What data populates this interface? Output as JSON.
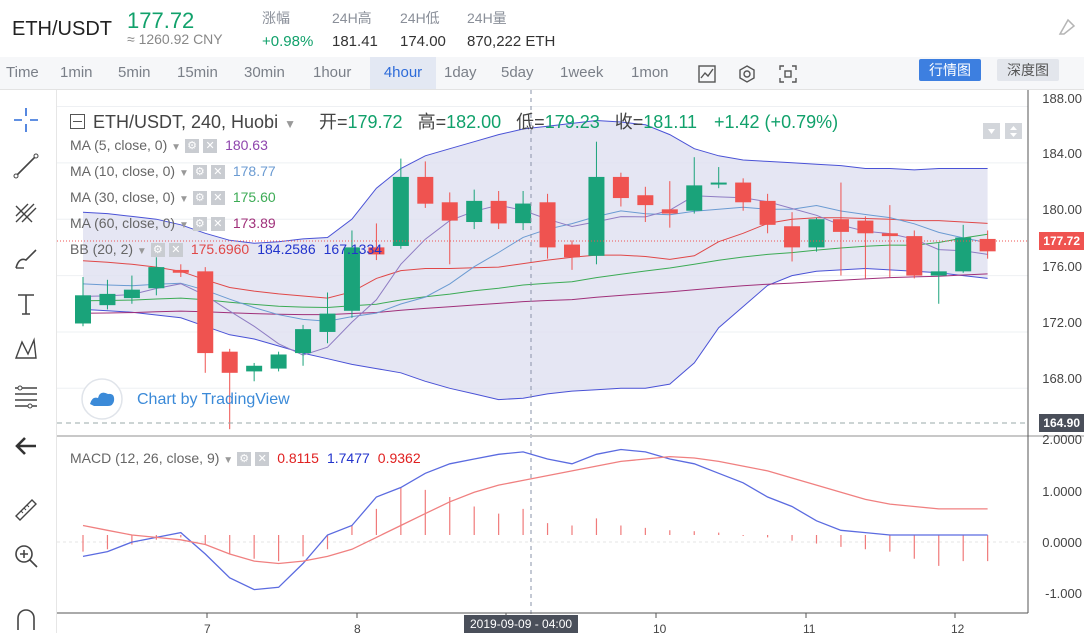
{
  "ticker": {
    "pair": "ETH/USDT",
    "price": "177.72",
    "cny": "≈ 1260.92 CNY",
    "stats": [
      {
        "label": "涨幅",
        "value": "+0.98%",
        "color": "green"
      },
      {
        "label": "24H高",
        "value": "181.41"
      },
      {
        "label": "24H低",
        "value": "174.00"
      },
      {
        "label": "24H量",
        "value": "870,222 ETH"
      }
    ]
  },
  "timeframes": [
    "Time",
    "1min",
    "5min",
    "15min",
    "30min",
    "1hour",
    "4hour",
    "1day",
    "5day",
    "1week",
    "1mon"
  ],
  "active_timeframe": "4hour",
  "view_modes": {
    "kline": "行情图",
    "depth": "深度图"
  },
  "chart_header": {
    "symbol": "ETH/USDT, 240, Huobi",
    "open_label": "开=",
    "open": "179.72",
    "high_label": "高=",
    "high": "182.00",
    "low_label": "低=",
    "low": "179.23",
    "close_label": "收=",
    "close": "181.11",
    "change": "+1.42 (+0.79%)"
  },
  "indicators": [
    {
      "name": "MA (5, close, 0)",
      "value": "180.63",
      "color": "#8e44ad"
    },
    {
      "name": "MA (10, close, 0)",
      "value": "178.77",
      "color": "#6b9bd2"
    },
    {
      "name": "MA (30, close, 0)",
      "value": "175.60",
      "color": "#3cab55"
    },
    {
      "name": "MA (60, close, 0)",
      "value": "173.89",
      "color": "#a0307a"
    }
  ],
  "bb": {
    "name": "BB (20, 2)",
    "v1": "175.6960",
    "v2": "184.2586",
    "v3": "167.1334"
  },
  "macd": {
    "name": "MACD (12, 26, close, 9)",
    "v1": "0.8115",
    "v2": "1.7477",
    "v3": "0.9362"
  },
  "watermark": "Chart by TradingView",
  "price_axis": [
    "188.00",
    "184.00",
    "180.00",
    "176.00",
    "172.00",
    "168.00"
  ],
  "macd_axis": [
    "2.0000",
    "1.0000",
    "0.0000",
    "-1.000"
  ],
  "current_price_badge": "177.72",
  "low_badge": "164.90",
  "crosshair_time": "2019-09-09 - 04:00",
  "x_labels": [
    "7",
    "8",
    "9",
    "10",
    "11",
    "12"
  ],
  "colors": {
    "up": "#1aa37a",
    "down": "#ef5350",
    "accent": "#3d7fe0"
  },
  "chart_data": {
    "type": "candlestick",
    "interval": "4hour",
    "candles": [
      {
        "o": 172.6,
        "h": 175.9,
        "l": 172.4,
        "c": 174.6
      },
      {
        "o": 173.9,
        "h": 175.7,
        "l": 173.6,
        "c": 174.7
      },
      {
        "o": 174.4,
        "h": 176.0,
        "l": 174.0,
        "c": 175.0
      },
      {
        "o": 175.1,
        "h": 177.3,
        "l": 174.6,
        "c": 176.6
      },
      {
        "o": 176.4,
        "h": 176.8,
        "l": 175.9,
        "c": 176.2
      },
      {
        "o": 176.3,
        "h": 176.6,
        "l": 169.1,
        "c": 170.5
      },
      {
        "o": 170.6,
        "h": 170.8,
        "l": 165.1,
        "c": 169.1
      },
      {
        "o": 169.2,
        "h": 169.8,
        "l": 168.5,
        "c": 169.6
      },
      {
        "o": 169.4,
        "h": 170.6,
        "l": 169.2,
        "c": 170.4
      },
      {
        "o": 170.5,
        "h": 172.5,
        "l": 169.6,
        "c": 172.2
      },
      {
        "o": 172.0,
        "h": 174.8,
        "l": 171.2,
        "c": 173.3
      },
      {
        "o": 173.5,
        "h": 179.2,
        "l": 173.0,
        "c": 178.0
      },
      {
        "o": 178.0,
        "h": 179.7,
        "l": 177.1,
        "c": 177.5
      },
      {
        "o": 178.1,
        "h": 184.3,
        "l": 177.9,
        "c": 183.0
      },
      {
        "o": 183.0,
        "h": 184.1,
        "l": 180.8,
        "c": 181.1
      },
      {
        "o": 181.2,
        "h": 181.9,
        "l": 176.8,
        "c": 179.9
      },
      {
        "o": 179.8,
        "h": 182.1,
        "l": 179.3,
        "c": 181.3
      },
      {
        "o": 181.3,
        "h": 182.0,
        "l": 179.3,
        "c": 179.7
      },
      {
        "o": 179.72,
        "h": 182.0,
        "l": 179.23,
        "c": 181.11
      },
      {
        "o": 181.2,
        "h": 181.8,
        "l": 177.2,
        "c": 178.0
      },
      {
        "o": 178.2,
        "h": 178.5,
        "l": 176.4,
        "c": 177.3
      },
      {
        "o": 177.4,
        "h": 185.5,
        "l": 176.8,
        "c": 183.0
      },
      {
        "o": 183.0,
        "h": 183.3,
        "l": 180.9,
        "c": 181.5
      },
      {
        "o": 181.7,
        "h": 182.3,
        "l": 179.8,
        "c": 181.0
      },
      {
        "o": 180.7,
        "h": 182.7,
        "l": 179.4,
        "c": 180.4
      },
      {
        "o": 180.6,
        "h": 184.4,
        "l": 180.4,
        "c": 182.4
      },
      {
        "o": 182.6,
        "h": 183.7,
        "l": 182.2,
        "c": 182.6
      },
      {
        "o": 182.6,
        "h": 182.9,
        "l": 180.6,
        "c": 181.2
      },
      {
        "o": 181.3,
        "h": 181.8,
        "l": 179.0,
        "c": 179.6
      },
      {
        "o": 179.5,
        "h": 180.5,
        "l": 177.0,
        "c": 178.0
      },
      {
        "o": 178.0,
        "h": 180.1,
        "l": 177.7,
        "c": 180.0
      },
      {
        "o": 180.0,
        "h": 182.6,
        "l": 176.0,
        "c": 179.1
      },
      {
        "o": 179.9,
        "h": 180.2,
        "l": 175.8,
        "c": 179.0
      },
      {
        "o": 179.0,
        "h": 181.0,
        "l": 175.9,
        "c": 178.8
      },
      {
        "o": 178.8,
        "h": 179.2,
        "l": 175.8,
        "c": 176.0
      },
      {
        "o": 176.0,
        "h": 178.3,
        "l": 174.0,
        "c": 176.3
      },
      {
        "o": 176.3,
        "h": 179.6,
        "l": 176.2,
        "c": 178.7
      },
      {
        "o": 178.6,
        "h": 179.2,
        "l": 177.2,
        "c": 177.72
      }
    ],
    "bb_upper": [
      180.5,
      180.4,
      180.2,
      180.0,
      179.6,
      179.0,
      178.5,
      178.3,
      178.4,
      178.6,
      178.7,
      180.0,
      182.2,
      183.6,
      184.5,
      185.0,
      185.5,
      186.0,
      186.4,
      186.6,
      186.8,
      187.0,
      186.9,
      186.7,
      186.0,
      185.0,
      184.5,
      184.2,
      184.1,
      184.0,
      183.9,
      183.8,
      183.6,
      183.6,
      183.5,
      183.6,
      183.6,
      183.6
    ],
    "bb_lower": [
      173.6,
      173.5,
      173.4,
      173.2,
      173.0,
      172.4,
      171.8,
      171.5,
      171.0,
      170.5,
      170.1,
      169.7,
      169.4,
      169.1,
      168.5,
      168.0,
      167.6,
      167.2,
      167.3,
      167.6,
      167.8,
      167.9,
      168.0,
      168.0,
      168.3,
      169.8,
      172.3,
      173.8,
      175.3,
      176.0,
      176.3,
      176.4,
      176.5,
      176.4,
      176.3,
      176.2,
      176.0,
      175.8
    ],
    "macd_hist": [
      -0.35,
      -0.3,
      -0.2,
      -0.1,
      -0.05,
      -0.2,
      -0.4,
      -0.5,
      -0.55,
      -0.45,
      -0.3,
      0.2,
      0.55,
      1.0,
      0.95,
      0.8,
      0.6,
      0.45,
      0.55,
      0.25,
      0.2,
      0.35,
      0.2,
      0.15,
      0.1,
      0.08,
      0.05,
      -0.02,
      -0.05,
      -0.12,
      -0.18,
      -0.25,
      -0.3,
      -0.35,
      -0.5,
      -0.65,
      -0.55,
      -0.55
    ],
    "macd_line": [
      -0.45,
      -0.35,
      -0.15,
      -0.05,
      0.05,
      -0.4,
      -0.9,
      -1.15,
      -1.1,
      -0.6,
      0.0,
      0.2,
      0.8,
      1.0,
      1.3,
      1.5,
      1.6,
      1.7,
      1.75,
      1.6,
      1.5,
      1.7,
      1.8,
      1.75,
      1.6,
      1.5,
      1.3,
      1.1,
      0.8,
      0.6,
      0.3,
      0.1,
      0.05,
      0.0,
      0.0,
      0.0,
      0.0,
      0.0
    ],
    "signal_line": [
      0.2,
      0.1,
      0.0,
      -0.05,
      -0.1,
      -0.2,
      -0.4,
      -0.55,
      -0.6,
      -0.55,
      -0.45,
      -0.3,
      -0.05,
      0.2,
      0.45,
      0.7,
      0.9,
      1.05,
      1.15,
      1.25,
      1.35,
      1.45,
      1.55,
      1.6,
      1.65,
      1.62,
      1.55,
      1.45,
      1.35,
      1.2,
      1.05,
      0.9,
      0.75,
      0.65,
      0.6,
      0.55,
      0.55,
      0.55
    ],
    "ylim_price": [
      164.9,
      188.6
    ],
    "ylim_macd": [
      -1.2,
      2.0
    ]
  }
}
